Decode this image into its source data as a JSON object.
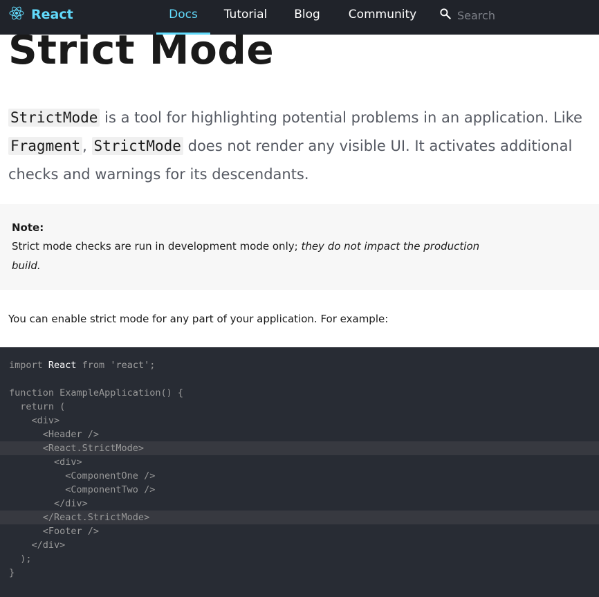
{
  "header": {
    "logo_text": "React",
    "nav": [
      {
        "label": "Docs",
        "active": true
      },
      {
        "label": "Tutorial",
        "active": false
      },
      {
        "label": "Blog",
        "active": false
      },
      {
        "label": "Community",
        "active": false
      }
    ],
    "search_placeholder": "Search"
  },
  "page": {
    "title": "Strict Mode",
    "intro": {
      "code_strictmode": "StrictMode",
      "text1": " is a tool for highlighting potential problems in an application. Like ",
      "code_fragment": "Fragment",
      "text2": ", ",
      "code_strictmode2": "StrictMode",
      "text3": " does not render any visible UI. It activates additional checks and warnings for its descendants."
    },
    "note": {
      "title": "Note:",
      "text": "Strict mode checks are run in development mode only; ",
      "emphasis": "they do not impact the production build."
    },
    "example_intro": "You can enable strict mode for any part of your application. For example:"
  },
  "code": {
    "lines": [
      "import React from 'react';",
      "",
      "function ExampleApplication() {",
      "  return (",
      "    <div>",
      "      <Header />",
      "      <React.StrictMode>",
      "        <div>",
      "          <ComponentOne />",
      "          <ComponentTwo />",
      "        </div>",
      "      </React.StrictMode>",
      "      <Footer />",
      "    </div>",
      "  );",
      "}"
    ],
    "highlighted_lines": [
      6,
      11
    ]
  },
  "colors": {
    "header_bg": "#20232a",
    "accent": "#61dafb",
    "code_bg": "#282c34",
    "code_highlight": "#373940",
    "note_bg": "#f7f7f7"
  }
}
